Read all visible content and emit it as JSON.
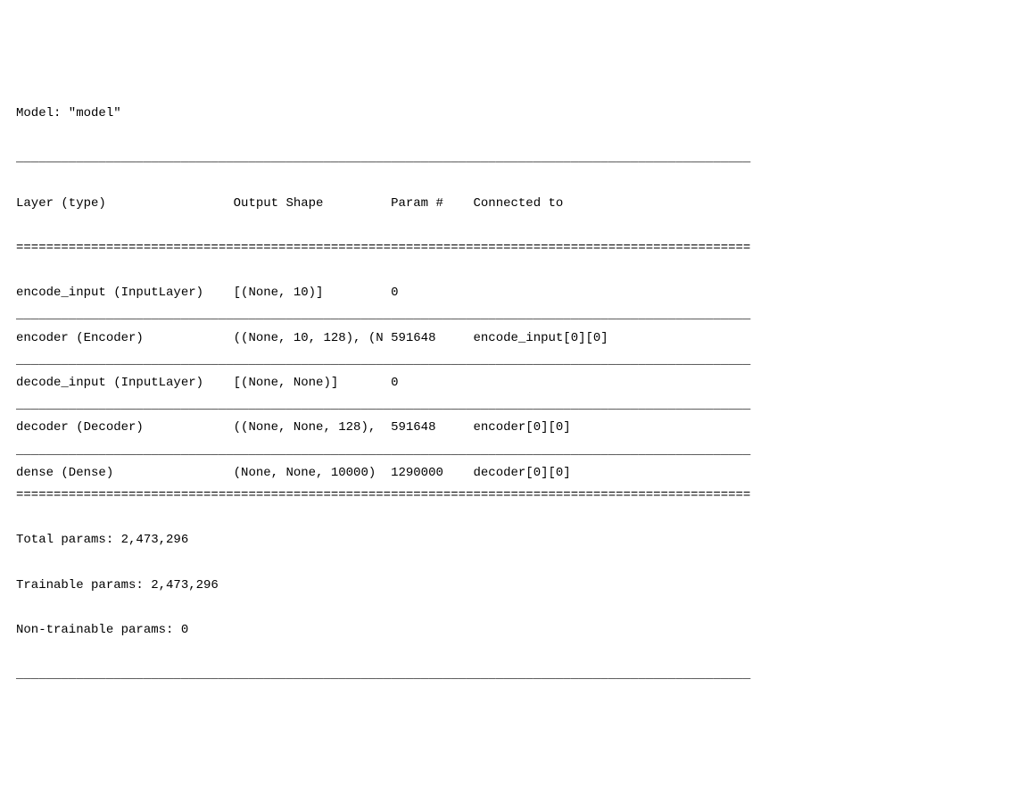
{
  "model_name_line": "Model: \"model\"",
  "hr_underscore": "__________________________________________________________________________________________________",
  "hr_equals": "==================================================================================================",
  "header": {
    "col1": "Layer (type)",
    "col2": "Output Shape",
    "col3": "Param #",
    "col4": "Connected to"
  },
  "rows": [
    {
      "layer": "encode_input (InputLayer)",
      "output_shape": "[(None, 10)]",
      "param": "0",
      "connected_to": ""
    },
    {
      "layer": "encoder (Encoder)",
      "output_shape": "((None, 10, 128), (N",
      "param": "591648",
      "connected_to": "encode_input[0][0]"
    },
    {
      "layer": "decode_input (InputLayer)",
      "output_shape": "[(None, None)]",
      "param": "0",
      "connected_to": ""
    },
    {
      "layer": "decoder (Decoder)",
      "output_shape": "((None, None, 128),",
      "param": "591648",
      "connected_to": "encoder[0][0]"
    },
    {
      "layer": "dense (Dense)",
      "output_shape": "(None, None, 10000)",
      "param": "1290000",
      "connected_to": "decoder[0][0]"
    }
  ],
  "footer": {
    "total_params": "Total params: 2,473,296",
    "trainable_params": "Trainable params: 2,473,296",
    "non_trainable_params": "Non-trainable params: 0"
  },
  "col_widths": {
    "c1": 29,
    "c2": 21,
    "c3": 11
  }
}
